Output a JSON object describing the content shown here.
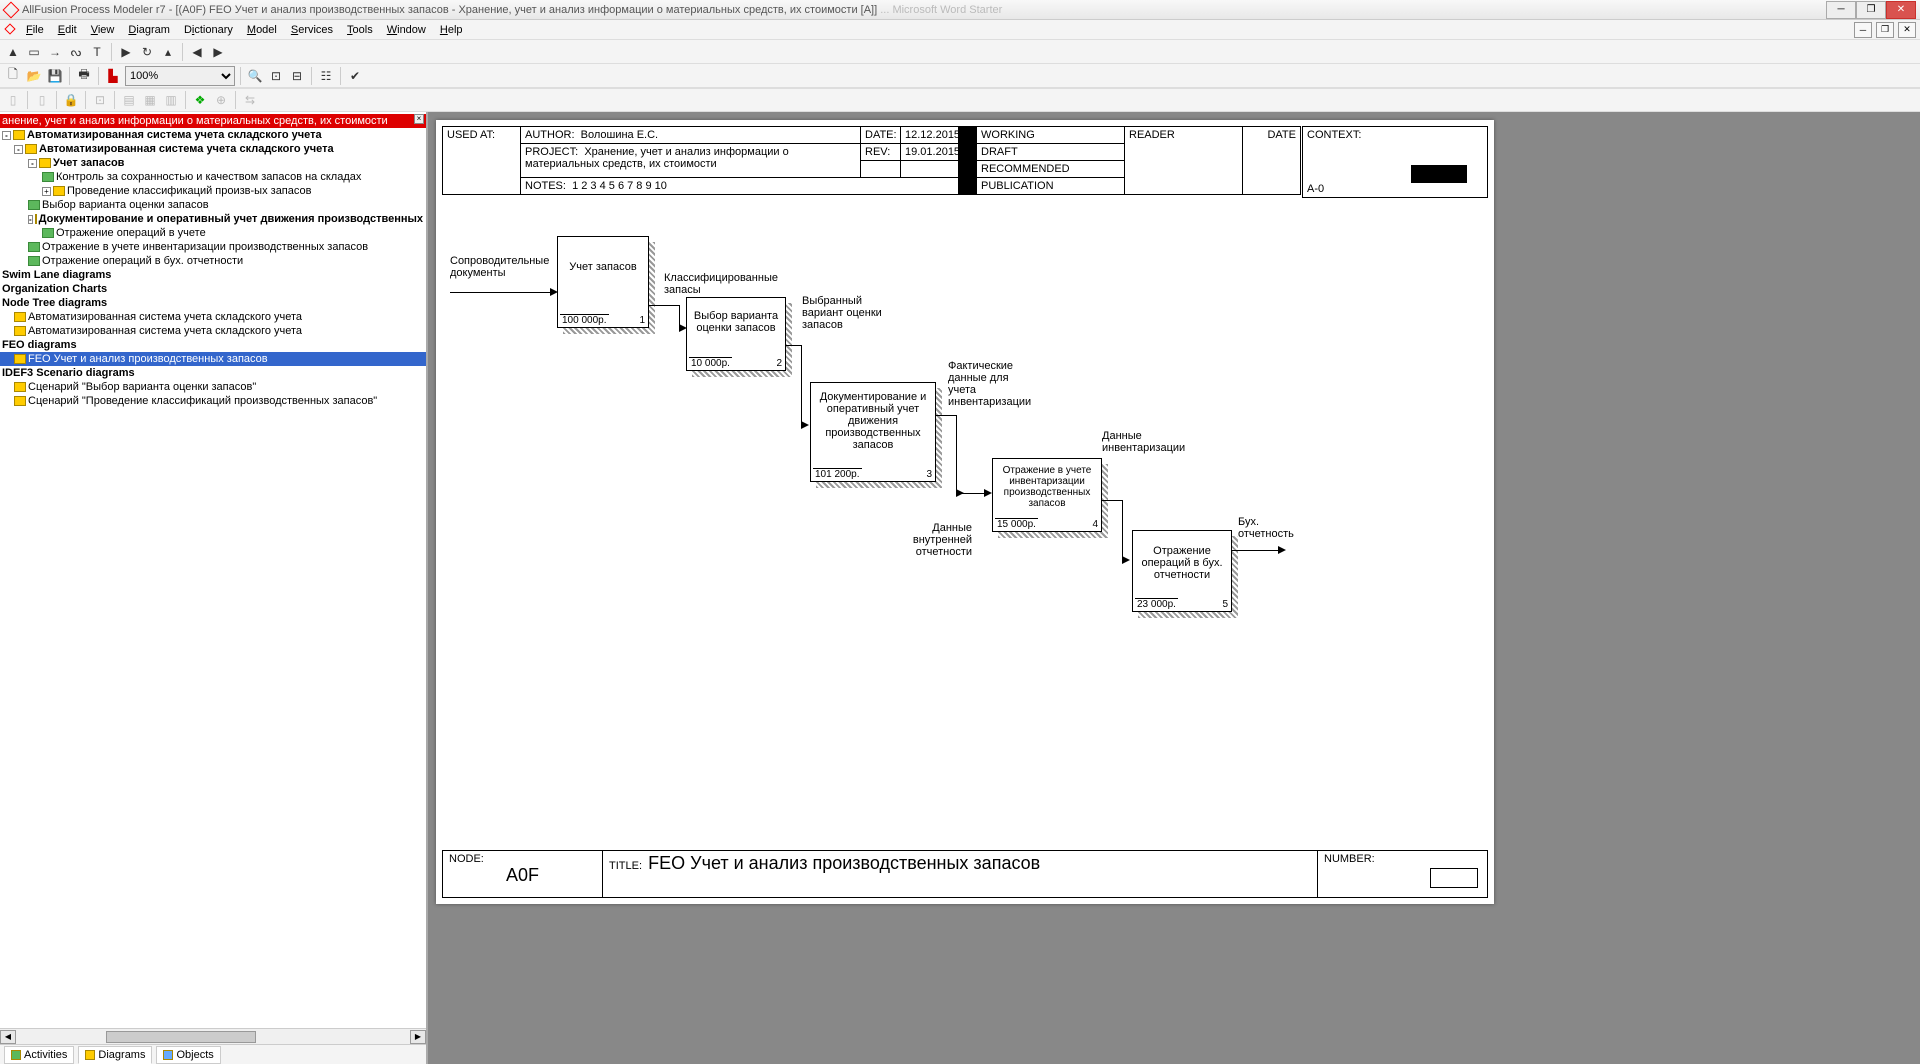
{
  "window": {
    "title_app": "AllFusion Process Modeler r7",
    "title_doc": " - [(A0F) FEO Учет и анализ производственных запасов - Хранение, учет и анализ информации о материальных средств, их стоимости  [A]]",
    "title_faded": "    ...   Microsoft Word Starter"
  },
  "menu": [
    "File",
    "Edit",
    "View",
    "Diagram",
    "Dictionary",
    "Model",
    "Services",
    "Tools",
    "Window",
    "Help"
  ],
  "zoom": "100%",
  "tree": {
    "n0": "анение, учет и анализ информации о материальных средств, их стоимости",
    "n1": "Автоматизированная система учета складского учета",
    "n2": "Автоматизированная система учета складского учета",
    "n3": "Учет запасов",
    "n4": "Контроль за  сохранностью и качеством запасов на складах",
    "n5": "Проведение  классификаций произв-ых  запасов",
    "n6": "Выбор варианта  оценки запасов",
    "n7": "Документирование  и оперативный учет  движения производственных  запасов",
    "n8": "Отражение операций в учете",
    "n9": "Отражение в учете  инвентаризации  производственных  запасов",
    "n10": "Отражение  операций в  бух. отчетности",
    "g1": "Swim Lane diagrams",
    "g2": "Organization Charts",
    "g3": "Node Tree diagrams",
    "n11": "Автоматизированная система учета складского учета",
    "n12": "Автоматизированная система учета складского учета",
    "g4": "FEO diagrams",
    "n13": "FEO Учет и анализ производственных запасов",
    "g5": "IDEF3 Scenario diagrams",
    "n14": "Сценарий \"Выбор варианта оценки запасов\"",
    "n15": "Сценарий \"Проведение классификаций производственных запасов\""
  },
  "tabs": {
    "activities": "Activities",
    "diagrams": "Diagrams",
    "objects": "Objects"
  },
  "header": {
    "used_at": "USED AT:",
    "author_l": "AUTHOR:",
    "author_v": "Волошина Е.С.",
    "project_l": "PROJECT:",
    "project_v": "Хранение, учет и анализ информации о материальных средств, их стоимости",
    "date_l": "DATE:",
    "date_v": "12.12.2015",
    "rev_l": "REV:",
    "rev_v": "19.01.2015",
    "notes_l": "NOTES:",
    "notes_v": "1  2  3  4  5  6  7  8  9  10",
    "working": "WORKING",
    "draft": "DRAFT",
    "recommended": "RECOMMENDED",
    "publication": "PUBLICATION",
    "reader": "READER",
    "hdate": "DATE",
    "context": "CONTEXT:",
    "a0": "A-0"
  },
  "boxes": {
    "b1": {
      "t": "Учет запасов",
      "c": "100 000р.",
      "n": "1"
    },
    "b2": {
      "t": "Выбор варианта оценки запасов",
      "c": "10 000р.",
      "n": "2"
    },
    "b3": {
      "t": "Документирование и оперативный учет движения производственных запасов",
      "c": "101 200р.",
      "n": "3"
    },
    "b4": {
      "t": "Отражение в учете инвентаризации производственных запасов",
      "c": "15 000р.",
      "n": "4"
    },
    "b5": {
      "t": "Отражение операций в бух. отчетности",
      "c": "23 000р.",
      "n": "5"
    }
  },
  "labels": {
    "l1": "Сопроводительные документы",
    "l2": "Классифицированные запасы",
    "l3": "Выбранный вариант оценки запасов",
    "l4": "Фактические данные для учета инвентаризации",
    "l5": "Данные инвентаризации",
    "l6": "Данные внутренней отчетности",
    "l7": "Бух. отчетность"
  },
  "footer": {
    "node_l": "NODE:",
    "node_v": "A0F",
    "title_l": "TITLE:",
    "title_v": "FEO Учет и анализ производственных запасов",
    "number_l": "NUMBER:"
  }
}
